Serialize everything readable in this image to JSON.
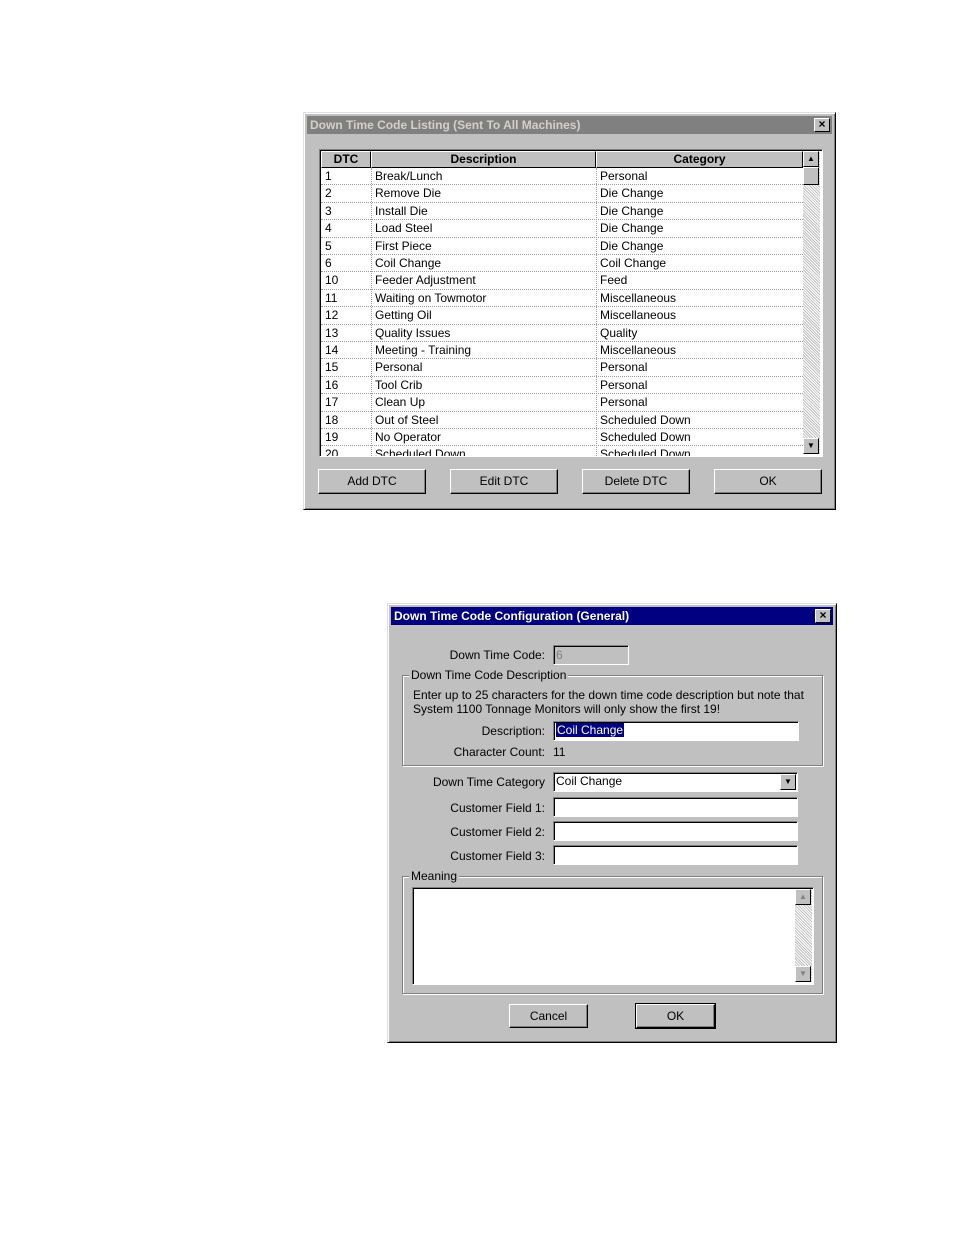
{
  "listing_dialog": {
    "title": "Down Time Code Listing (Sent To All Machines)",
    "columns": [
      "DTC",
      "Description",
      "Category"
    ],
    "rows": [
      {
        "dtc": "1",
        "description": "Break/Lunch",
        "category": "Personal"
      },
      {
        "dtc": "2",
        "description": "Remove Die",
        "category": "Die Change"
      },
      {
        "dtc": "3",
        "description": "Install Die",
        "category": "Die Change"
      },
      {
        "dtc": "4",
        "description": "Load Steel",
        "category": "Die Change"
      },
      {
        "dtc": "5",
        "description": "First Piece",
        "category": "Die Change"
      },
      {
        "dtc": "6",
        "description": "Coil Change",
        "category": "Coil Change"
      },
      {
        "dtc": "10",
        "description": "Feeder Adjustment",
        "category": "Feed"
      },
      {
        "dtc": "11",
        "description": "Waiting on Towmotor",
        "category": "Miscellaneous"
      },
      {
        "dtc": "12",
        "description": "Getting Oil",
        "category": "Miscellaneous"
      },
      {
        "dtc": "13",
        "description": "Quality Issues",
        "category": "Quality"
      },
      {
        "dtc": "14",
        "description": "Meeting - Training",
        "category": "Miscellaneous"
      },
      {
        "dtc": "15",
        "description": "Personal",
        "category": "Personal"
      },
      {
        "dtc": "16",
        "description": "Tool Crib",
        "category": "Personal"
      },
      {
        "dtc": "17",
        "description": "Clean Up",
        "category": "Personal"
      },
      {
        "dtc": "18",
        "description": "Out of Steel",
        "category": "Scheduled Down"
      },
      {
        "dtc": "19",
        "description": "No Operator",
        "category": "Scheduled Down"
      },
      {
        "dtc": "20",
        "description": "Scheduled Down",
        "category": "Scheduled Down"
      }
    ],
    "buttons": {
      "add": "Add DTC",
      "edit": "Edit DTC",
      "delete": "Delete DTC",
      "ok": "OK"
    },
    "close": "×"
  },
  "config_dialog": {
    "title": "Down Time Code Configuration (General)",
    "close": "×",
    "code_label": "Down Time Code:",
    "code_value": "6",
    "desc_group": "Down Time Code Description",
    "desc_help": "Enter up to 25 characters for the down time code description but note that System 1100 Tonnage Monitors will only show the first 19!",
    "desc_label": "Description:",
    "desc_value": "Coil Change",
    "char_count_label": "Character Count:",
    "char_count_value": "11",
    "category_label": "Down Time Category",
    "category_value": "Coil Change",
    "cf1_label": "Customer Field 1:",
    "cf2_label": "Customer Field 2:",
    "cf3_label": "Customer Field 3:",
    "cf1_value": "",
    "cf2_value": "",
    "cf3_value": "",
    "meaning_group": "Meaning",
    "meaning_value": "",
    "cancel": "Cancel",
    "ok": "OK"
  }
}
